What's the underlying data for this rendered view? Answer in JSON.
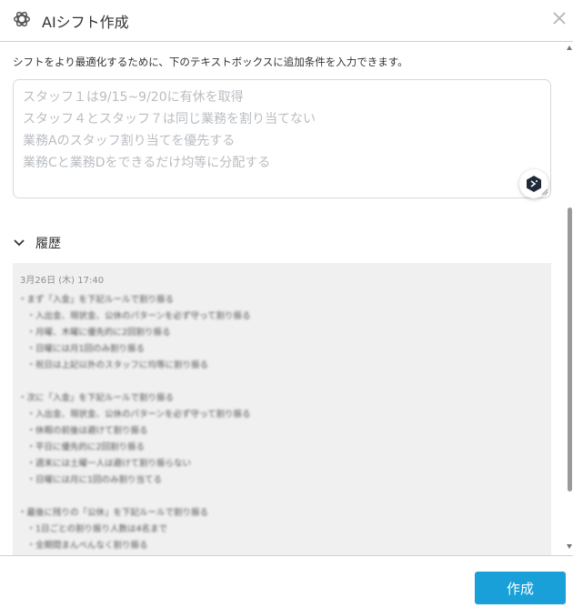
{
  "header": {
    "title": "AIシフト作成",
    "logo_icon": "openai-logo-icon",
    "close_icon": "close-icon"
  },
  "main": {
    "description": "シフトをより最適化するために、下のテキストボックスに追加条件を入力できます。",
    "placeholder_lines": [
      "スタッフ１は9/15~9/20に有休を取得",
      "スタッフ４とスタッフ７は同じ業務を割り当てない",
      "業務Aのスタッフ割り当てを優先する",
      "業務Cと業務Dをできるだけ均等に分配する"
    ],
    "ai_button_icon": "ai-sparkle-icon"
  },
  "history": {
    "label": "履歴",
    "timestamp": "3月26日 (木) 17:40",
    "lines": [
      "・まず「入金」を下記ルールで割り振る",
      "　・入出金、現状金、公休のパターンを必ず守って割り振る",
      "　・月曜、木曜に優先的に2回割り振る",
      "　・日曜には月1回のみ割り振る",
      "　・祝日は上記以外のスタッフに均等に割り振る",
      "",
      "・次に「入金」を下記ルールで割り振る",
      "　・入出金、現状金、公休のパターンを必ず守って割り振る",
      "　・休暇の前後は避けて割り振る",
      "　・平日に優先的に2回割り振る",
      "　・週末には土曜一人は避けて割り振らない",
      "　・日曜には月に1回のみ割り当てる",
      "",
      "・最後に残りの「公休」を下記ルールで割り振る",
      "　・1日ごとの割り振り人数は4名まで",
      "　・全期間まんべんなく割り振る"
    ]
  },
  "footer": {
    "create_label": "作成"
  },
  "colors": {
    "accent": "#1aa0d8",
    "history_bg": "#f0f0f0"
  }
}
